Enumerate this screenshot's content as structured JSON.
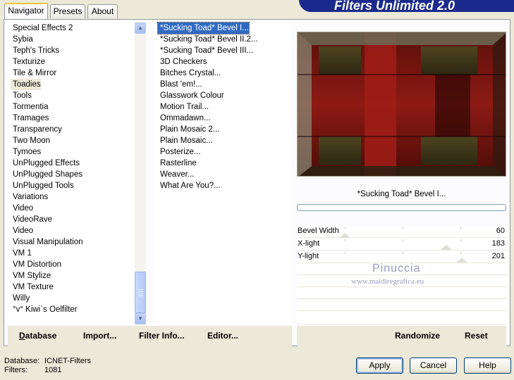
{
  "header": {
    "title": "Filters Unlimited 2.0"
  },
  "tabs": [
    {
      "label": "Navigator",
      "active": true
    },
    {
      "label": "Presets",
      "active": false
    },
    {
      "label": "About",
      "active": false
    }
  ],
  "categories": [
    "Special Effects 2",
    "Sybia",
    "Teph's Tricks",
    "Texturize",
    "Tile & Mirror",
    "Toadies",
    "Tools",
    "Tormentia",
    "Tramages",
    "Transparency",
    "Two Moon",
    "Tymoes",
    "UnPlugged Effects",
    "UnPlugged Shapes",
    "UnPlugged Tools",
    "Variations",
    "Video",
    "VideoRave",
    "Video",
    "Visual Manipulation",
    "VM 1",
    "VM Distortion",
    "VM Stylize",
    "VM Texture",
    "Willy",
    "°v° Kiwi`s Oelfilter"
  ],
  "selected_category": "Toadies",
  "filters": [
    "*Sucking Toad*  Bevel I...",
    "*Sucking Toad*  Bevel II.2...",
    "*Sucking Toad*  Bevel III...",
    "3D Checkers",
    "Bitches Crystal...",
    "Blast 'em!...",
    "Glasswork Colour",
    "Motion Trail...",
    "Ommadawn...",
    "Plain Mosaic 2...",
    "Plain Mosaic...",
    "Posterize...",
    "Rasterline",
    "Weaver...",
    "What Are You?..."
  ],
  "selected_filter": "*Sucking Toad*  Bevel I...",
  "left_buttons": {
    "database": "Database",
    "import": "Import...",
    "filter_info": "Filter Info...",
    "editor": "Editor..."
  },
  "right_buttons": {
    "randomize": "Randomize",
    "reset": "Reset"
  },
  "preview": {
    "filter_name": "*Sucking Toad*  Bevel I..."
  },
  "params": [
    {
      "name": "Bevel Width",
      "value": "60"
    },
    {
      "name": "X-light",
      "value": "183"
    },
    {
      "name": "Y-light",
      "value": "201"
    }
  ],
  "watermark": {
    "line1": "Pinuccia",
    "line2": "www.maidiregrafica.eu"
  },
  "status": {
    "database_label": "Database:",
    "database_value": "ICNET-Filters",
    "filters_label": "Filters:",
    "filters_value": "1081"
  },
  "dialog_buttons": {
    "apply": "Apply",
    "cancel": "Cancel",
    "help": "Help"
  },
  "colors": {
    "selection": "#316ac5",
    "banner": "#1b2a8c",
    "face": "#ece9d8"
  },
  "icons": {
    "scroll_up": "triangle-up",
    "scroll_down": "triangle-down"
  }
}
